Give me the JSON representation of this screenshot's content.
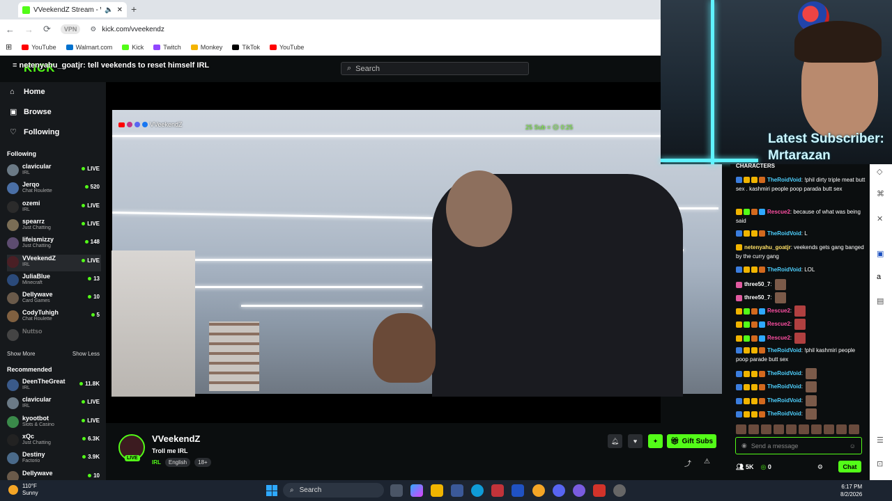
{
  "browser": {
    "tab_title": "VVeekendZ Stream - Watch",
    "url": "kick.com/vveekendz",
    "vpn_label": "VPN",
    "bookmarks": [
      {
        "label": "YouTube",
        "color": "#ff0000"
      },
      {
        "label": "Walmart.com",
        "color": "#0071ce"
      },
      {
        "label": "Kick",
        "color": "#53fc18"
      },
      {
        "label": "Twitch",
        "color": "#9146ff"
      },
      {
        "label": "Monkey",
        "color": "#f4b400"
      },
      {
        "label": "TikTok",
        "color": "#000000"
      },
      {
        "label": "YouTube",
        "color": "#ff0000"
      }
    ]
  },
  "kick": {
    "logo": "KICK",
    "ticker": "netenyahu_goatjr: tell veekends to reset himself IRL",
    "search_placeholder": "Search",
    "nav": [
      {
        "label": "Home",
        "icon": "home-icon"
      },
      {
        "label": "Browse",
        "icon": "browse-icon"
      },
      {
        "label": "Following",
        "icon": "heart-icon"
      }
    ],
    "following_title": "Following",
    "following": [
      {
        "name": "clavicular",
        "category": "IRL",
        "viewers": "LIVE",
        "avatar": "#6b7a86"
      },
      {
        "name": "Jerqo",
        "category": "Chat Roulette",
        "viewers": "520",
        "avatar": "#4a6fa5"
      },
      {
        "name": "ozemi",
        "category": "IRL",
        "viewers": "LIVE",
        "avatar": "#2b2b2b"
      },
      {
        "name": "spearrz",
        "category": "Just Chatting",
        "viewers": "LIVE",
        "avatar": "#7a6d55"
      },
      {
        "name": "lifeismizzy",
        "category": "Just Chatting",
        "viewers": "148",
        "avatar": "#5d4c70"
      },
      {
        "name": "VVeekendZ",
        "category": "IRL",
        "viewers": "LIVE",
        "avatar": "#4a1f25"
      },
      {
        "name": "JuliaBlue",
        "category": "Minecraft",
        "viewers": "13",
        "avatar": "#2b4a7a"
      },
      {
        "name": "Dellywave",
        "category": "Card Games",
        "viewers": "10",
        "avatar": "#6a5a4a"
      },
      {
        "name": "CodyTuhigh",
        "category": "Chat Roulette",
        "viewers": "5",
        "avatar": "#806040"
      },
      {
        "name": "Nuttso",
        "category": "",
        "viewers": "",
        "avatar": "#444444"
      }
    ],
    "show_more": "Show More",
    "show_less": "Show Less",
    "recommended_title": "Recommended",
    "recommended": [
      {
        "name": "DeenTheGreat",
        "category": "IRL",
        "viewers": "11.8K",
        "avatar": "#3a5a8a"
      },
      {
        "name": "clavicular",
        "category": "IRL",
        "viewers": "LIVE",
        "avatar": "#6b7a86"
      },
      {
        "name": "kyootbot",
        "category": "Slots & Casino",
        "viewers": "LIVE",
        "avatar": "#3a8a4a"
      },
      {
        "name": "xQc",
        "category": "Just Chatting",
        "viewers": "6.3K",
        "avatar": "#222222"
      },
      {
        "name": "Destiny",
        "category": "Factorio",
        "viewers": "3.9K",
        "avatar": "#4a6a8a"
      },
      {
        "name": "Dellywave",
        "category": "",
        "viewers": "10",
        "avatar": "#6a5a4a"
      }
    ],
    "video_overlay_left": "VVeekendZ",
    "video_overlay_right": "25 Sub = ☹ 0:25",
    "channel": {
      "name": "VVeekendZ",
      "title": "Troll me IRL",
      "category": "IRL",
      "tags": [
        "English",
        "18+"
      ],
      "live_badge": "LIVE",
      "gift_label": "Gift Subs"
    },
    "webcam_sub_label": "Latest Subscriber:",
    "webcam_sub_name": "Mrtarazan",
    "chat": {
      "header": "CHARACTERS",
      "messages": [
        {
          "user": "TheRoidVoid",
          "color": "#4fd1ff",
          "text": " !phil dirty triple meat butt sex . kashmiri people poop parada butt sex",
          "badges": [
            "#3b7ddd",
            "#f0b400",
            "#f0b400",
            "#d2691e"
          ],
          "emote": false
        },
        {
          "user": "Rescue2",
          "color": "#ff4fa3",
          "text": " because of what was being said",
          "badges": [
            "#f0b400",
            "#53fc18",
            "#d2691e",
            "#2ea8ff"
          ],
          "emote": false
        },
        {
          "user": "TheRoidVoid",
          "color": "#4fd1ff",
          "text": " L",
          "badges": [
            "#3b7ddd",
            "#f0b400",
            "#f0b400",
            "#d2691e"
          ],
          "emote": false
        },
        {
          "user": "netenyahu_goatjr",
          "color": "#ffe066",
          "text": " veekends gets gang banged by the curry gang",
          "badges": [
            "#f0b400"
          ],
          "emote": false
        },
        {
          "user": "TheRoidVoid",
          "color": "#4fd1ff",
          "text": " LOL",
          "badges": [
            "#3b7ddd",
            "#f0b400",
            "#f0b400",
            "#d2691e"
          ],
          "emote": false
        },
        {
          "user": "three50_7",
          "color": "#ffffff",
          "text": "",
          "badges": [
            "#e05aa0"
          ],
          "emote": true
        },
        {
          "user": "three50_7",
          "color": "#ffffff",
          "text": "",
          "badges": [
            "#e05aa0"
          ],
          "emote": true
        },
        {
          "user": "Rescue2",
          "color": "#ff4fa3",
          "text": "",
          "badges": [
            "#f0b400",
            "#53fc18",
            "#d2691e",
            "#2ea8ff"
          ],
          "emote": true
        },
        {
          "user": "Rescue2",
          "color": "#ff4fa3",
          "text": "",
          "badges": [
            "#f0b400",
            "#53fc18",
            "#d2691e",
            "#2ea8ff"
          ],
          "emote": true
        },
        {
          "user": "Rescue2",
          "color": "#ff4fa3",
          "text": "",
          "badges": [
            "#f0b400",
            "#53fc18",
            "#d2691e",
            "#2ea8ff"
          ],
          "emote": true
        },
        {
          "user": "TheRoidVoid",
          "color": "#4fd1ff",
          "text": " !phil kashmiri people poop parade butt sex",
          "badges": [
            "#3b7ddd",
            "#f0b400",
            "#f0b400",
            "#d2691e"
          ],
          "emote": false
        },
        {
          "user": "TheRoidVoid",
          "color": "#4fd1ff",
          "text": "",
          "badges": [
            "#3b7ddd",
            "#f0b400",
            "#f0b400",
            "#d2691e"
          ],
          "emote": true
        },
        {
          "user": "TheRoidVoid",
          "color": "#4fd1ff",
          "text": "",
          "badges": [
            "#3b7ddd",
            "#f0b400",
            "#f0b400",
            "#d2691e"
          ],
          "emote": true
        },
        {
          "user": "TheRoidVoid",
          "color": "#4fd1ff",
          "text": "",
          "badges": [
            "#3b7ddd",
            "#f0b400",
            "#f0b400",
            "#d2691e"
          ],
          "emote": true
        },
        {
          "user": "TheRoidVoid",
          "color": "#4fd1ff",
          "text": "",
          "badges": [
            "#3b7ddd",
            "#f0b400",
            "#f0b400",
            "#d2691e"
          ],
          "emote": true
        }
      ],
      "input_placeholder": "Send a message",
      "viewers": "5K",
      "points": "0",
      "chat_button": "Chat"
    }
  },
  "taskbar": {
    "temp": "110°F",
    "weather": "Sunny",
    "search_label": "Search",
    "time": "6:17 PM",
    "date": "8/2/2026"
  },
  "colors": {
    "accent": "#53fc18"
  }
}
